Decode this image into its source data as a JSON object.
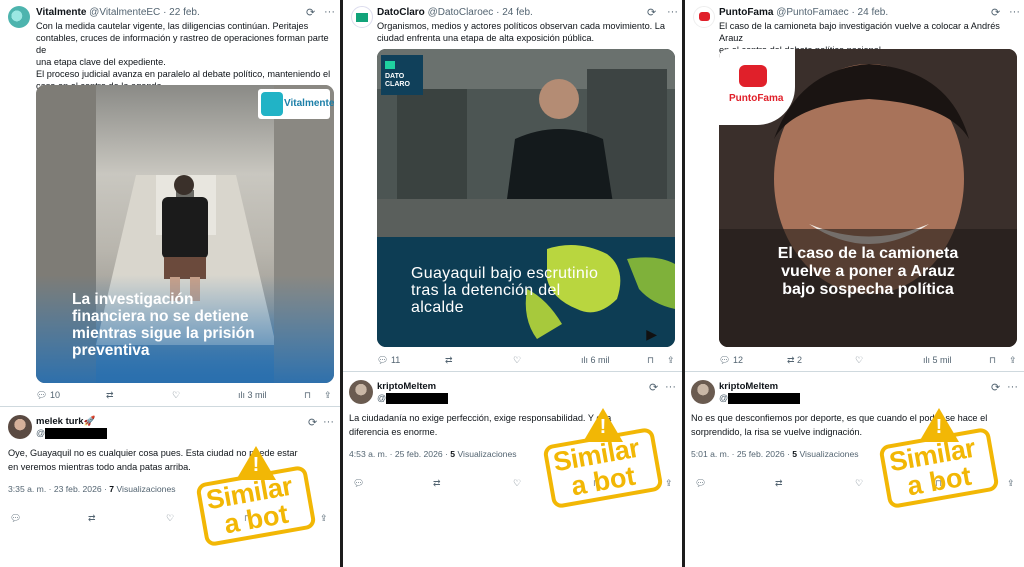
{
  "stamp": {
    "line1": "Similar",
    "line2": "a bot"
  },
  "panels": [
    {
      "tweet": {
        "name": "Vitalmente",
        "handle": "@VitalmenteEC",
        "date": "· 22 feb.",
        "lines": [
          "Con la medida cautelar vigente, las diligencias continúan. Peritajes",
          "contables, cruces de información y rastreo de operaciones forman parte de",
          "una etapa clave del expediente.",
          "El proceso judicial avanza en paralelo al debate político, manteniendo el",
          "caso en el centro de la agenda."
        ],
        "media_logo": "Vitalmente",
        "media_caption": [
          "La investigación",
          "financiera no se detiene",
          "mientras sigue la prisión",
          "preventiva"
        ],
        "replies": "10",
        "retweets": "",
        "likes": "",
        "views": "3 mil"
      },
      "reply": {
        "name": "melek turk🚀",
        "handle": "@",
        "lines": [
          "Oye, Guayaquil no es cualquier cosa pues. Esta ciudad no puede estar",
          "en veremos mientras todo anda patas arriba."
        ],
        "time": "3:35 a. m. · 23 feb. 2026 ·",
        "views_count": "7",
        "views_label": "Visualizaciones"
      }
    },
    {
      "tweet": {
        "name": "DatoClaro",
        "handle": "@DatoClaroec",
        "date": "· 24 feb.",
        "lines": [
          "Organismos, medios y actores políticos observan cada movimiento. La",
          "ciudad enfrenta una etapa de alta exposición pública."
        ],
        "media_logo": "DATO CLARO",
        "media_caption": [
          "Guayaquil bajo escrutinio",
          "tras la detención del",
          "alcalde"
        ],
        "replies": "11",
        "retweets": "",
        "likes": "",
        "views": "6 mil"
      },
      "reply": {
        "name": "kriptoMeltem",
        "handle": "@",
        "lines": [
          "La ciudadanía no exige perfección, exige responsabilidad. Y esa",
          "diferencia es enorme."
        ],
        "time": "4:53 a. m. · 25 feb. 2026 ·",
        "views_count": "5",
        "views_label": "Visualizaciones"
      }
    },
    {
      "tweet": {
        "name": "PuntoFama",
        "handle": "@PuntoFamaec",
        "date": "· 24 feb.",
        "lines": [
          "El caso de la camioneta bajo investigación vuelve a colocar a Andrés Arauz",
          "en el centro del debate político nacional."
        ],
        "media_logo": "PuntoFama",
        "media_caption": [
          "El caso de la camioneta",
          "vuelve a poner a Arauz",
          "bajo sospecha política"
        ],
        "replies": "12",
        "retweets": "2",
        "likes": "",
        "views": "5 mil"
      },
      "reply": {
        "name": "kriptoMeltem",
        "handle": "@",
        "lines": [
          "No es que desconfiemos por deporte, es que cuando el poder se hace el",
          "sorprendido, la risa se vuelve indignación."
        ],
        "time": "5:01 a. m. · 25 feb. 2026 ·",
        "views_count": "5",
        "views_label": "Visualizaciones"
      }
    }
  ],
  "icons": {
    "grok": "grok-icon",
    "more": "more-icon",
    "reply": "reply-icon",
    "retweet": "retweet-icon",
    "like": "like-icon",
    "views": "views-icon",
    "bookmark": "bookmark-icon",
    "share": "share-icon"
  },
  "colors": {
    "stamp_yellow": "#f2b705",
    "x_text": "#0f1419",
    "x_muted": "#536471"
  }
}
